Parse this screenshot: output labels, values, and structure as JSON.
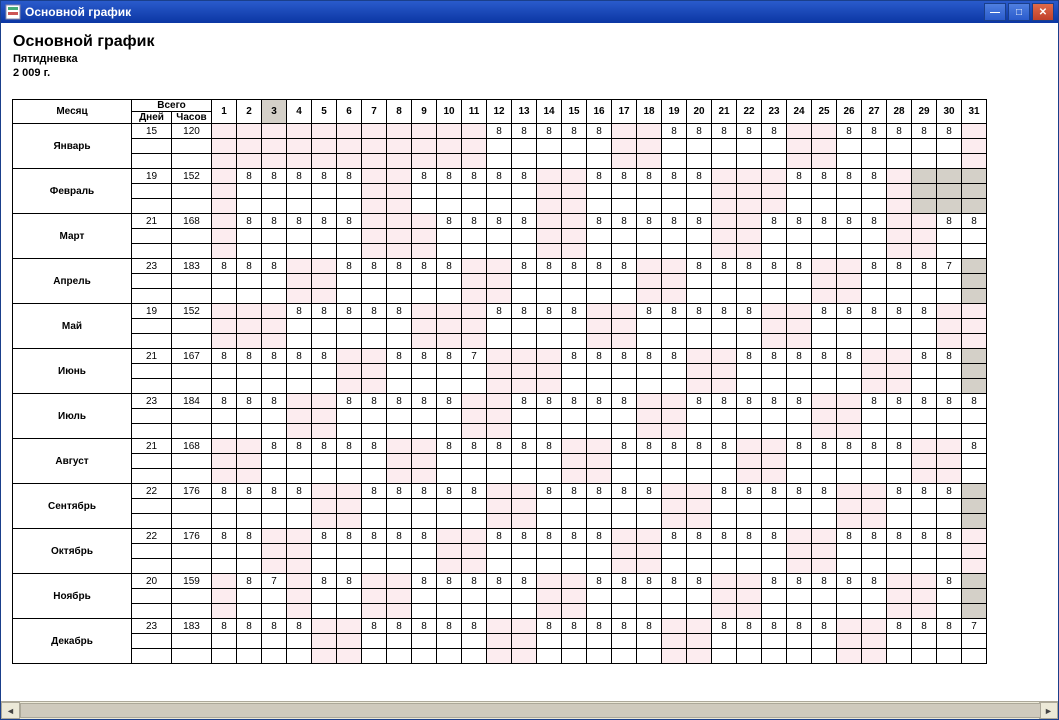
{
  "window": {
    "title": "Основной график"
  },
  "header": {
    "title": "Основной график",
    "subtitle1": "Пятидневка",
    "subtitle2": "2 009 г."
  },
  "cols": {
    "month": "Месяц",
    "total": "Всего",
    "days": "Дней",
    "hours": "Часов",
    "nums": [
      "1",
      "2",
      "3",
      "4",
      "5",
      "6",
      "7",
      "8",
      "9",
      "10",
      "11",
      "12",
      "13",
      "14",
      "15",
      "16",
      "17",
      "18",
      "19",
      "20",
      "21",
      "22",
      "23",
      "24",
      "25",
      "26",
      "27",
      "28",
      "29",
      "30",
      "31"
    ]
  },
  "selectedDay": 3,
  "months": [
    {
      "name": "Январь",
      "days": "15",
      "hours": "120",
      "len": 31,
      "wk": [
        1,
        2,
        3,
        4,
        5,
        6,
        7,
        8,
        9,
        10,
        11,
        17,
        18,
        24,
        25,
        31
      ],
      "cells": {
        "12": "8",
        "13": "8",
        "14": "8",
        "15": "8",
        "16": "8",
        "19": "8",
        "20": "8",
        "21": "8",
        "22": "8",
        "23": "8",
        "26": "8",
        "27": "8",
        "28": "8",
        "29": "8",
        "30": "8"
      }
    },
    {
      "name": "Февраль",
      "days": "19",
      "hours": "152",
      "len": 28,
      "wk": [
        1,
        7,
        8,
        14,
        15,
        21,
        22,
        23,
        28
      ],
      "cells": {
        "2": "8",
        "3": "8",
        "4": "8",
        "5": "8",
        "6": "8",
        "9": "8",
        "10": "8",
        "11": "8",
        "12": "8",
        "13": "8",
        "16": "8",
        "17": "8",
        "18": "8",
        "19": "8",
        "20": "8",
        "24": "8",
        "25": "8",
        "26": "8",
        "27": "8"
      }
    },
    {
      "name": "Март",
      "days": "21",
      "hours": "168",
      "len": 31,
      "wk": [
        1,
        7,
        8,
        9,
        14,
        15,
        21,
        22,
        28,
        29
      ],
      "cells": {
        "2": "8",
        "3": "8",
        "4": "8",
        "5": "8",
        "6": "8",
        "10": "8",
        "11": "8",
        "12": "8",
        "13": "8",
        "16": "8",
        "17": "8",
        "18": "8",
        "19": "8",
        "20": "8",
        "23": "8",
        "24": "8",
        "25": "8",
        "26": "8",
        "27": "8",
        "30": "8",
        "31": "8"
      }
    },
    {
      "name": "Апрель",
      "days": "23",
      "hours": "183",
      "len": 30,
      "wk": [
        4,
        5,
        11,
        12,
        18,
        19,
        25,
        26
      ],
      "cells": {
        "1": "8",
        "2": "8",
        "3": "8",
        "6": "8",
        "7": "8",
        "8": "8",
        "9": "8",
        "10": "8",
        "13": "8",
        "14": "8",
        "15": "8",
        "16": "8",
        "17": "8",
        "20": "8",
        "21": "8",
        "22": "8",
        "23": "8",
        "24": "8",
        "27": "8",
        "28": "8",
        "29": "8",
        "30": "7"
      }
    },
    {
      "name": "Май",
      "days": "19",
      "hours": "152",
      "len": 31,
      "wk": [
        1,
        2,
        3,
        9,
        10,
        11,
        16,
        17,
        23,
        24,
        30,
        31
      ],
      "cells": {
        "4": "8",
        "5": "8",
        "6": "8",
        "7": "8",
        "8": "8",
        "12": "8",
        "13": "8",
        "14": "8",
        "15": "8",
        "18": "8",
        "19": "8",
        "20": "8",
        "21": "8",
        "22": "8",
        "25": "8",
        "26": "8",
        "27": "8",
        "28": "8",
        "29": "8"
      }
    },
    {
      "name": "Июнь",
      "days": "21",
      "hours": "167",
      "len": 30,
      "wk": [
        6,
        7,
        12,
        13,
        14,
        20,
        21,
        27,
        28
      ],
      "cells": {
        "1": "8",
        "2": "8",
        "3": "8",
        "4": "8",
        "5": "8",
        "8": "8",
        "9": "8",
        "10": "8",
        "11": "7",
        "15": "8",
        "16": "8",
        "17": "8",
        "18": "8",
        "19": "8",
        "22": "8",
        "23": "8",
        "24": "8",
        "25": "8",
        "26": "8",
        "29": "8",
        "30": "8"
      }
    },
    {
      "name": "Июль",
      "days": "23",
      "hours": "184",
      "len": 31,
      "wk": [
        4,
        5,
        11,
        12,
        18,
        19,
        25,
        26
      ],
      "cells": {
        "1": "8",
        "2": "8",
        "3": "8",
        "6": "8",
        "7": "8",
        "8": "8",
        "9": "8",
        "10": "8",
        "13": "8",
        "14": "8",
        "15": "8",
        "16": "8",
        "17": "8",
        "20": "8",
        "21": "8",
        "22": "8",
        "23": "8",
        "24": "8",
        "27": "8",
        "28": "8",
        "29": "8",
        "30": "8",
        "31": "8"
      }
    },
    {
      "name": "Август",
      "days": "21",
      "hours": "168",
      "len": 31,
      "wk": [
        1,
        2,
        8,
        9,
        15,
        16,
        22,
        23,
        29,
        30
      ],
      "cells": {
        "3": "8",
        "4": "8",
        "5": "8",
        "6": "8",
        "7": "8",
        "10": "8",
        "11": "8",
        "12": "8",
        "13": "8",
        "14": "8",
        "17": "8",
        "18": "8",
        "19": "8",
        "20": "8",
        "21": "8",
        "24": "8",
        "25": "8",
        "26": "8",
        "27": "8",
        "28": "8",
        "31": "8"
      }
    },
    {
      "name": "Сентябрь",
      "days": "22",
      "hours": "176",
      "len": 30,
      "wk": [
        5,
        6,
        12,
        13,
        19,
        20,
        26,
        27
      ],
      "cells": {
        "1": "8",
        "2": "8",
        "3": "8",
        "4": "8",
        "7": "8",
        "8": "8",
        "9": "8",
        "10": "8",
        "11": "8",
        "14": "8",
        "15": "8",
        "16": "8",
        "17": "8",
        "18": "8",
        "21": "8",
        "22": "8",
        "23": "8",
        "24": "8",
        "25": "8",
        "28": "8",
        "29": "8",
        "30": "8"
      }
    },
    {
      "name": "Октябрь",
      "days": "22",
      "hours": "176",
      "len": 31,
      "wk": [
        3,
        4,
        10,
        11,
        17,
        18,
        24,
        25,
        31
      ],
      "cells": {
        "1": "8",
        "2": "8",
        "5": "8",
        "6": "8",
        "7": "8",
        "8": "8",
        "9": "8",
        "12": "8",
        "13": "8",
        "14": "8",
        "15": "8",
        "16": "8",
        "19": "8",
        "20": "8",
        "21": "8",
        "22": "8",
        "23": "8",
        "26": "8",
        "27": "8",
        "28": "8",
        "29": "8",
        "30": "8"
      }
    },
    {
      "name": "Ноябрь",
      "days": "20",
      "hours": "159",
      "len": 30,
      "wk": [
        1,
        4,
        7,
        8,
        14,
        15,
        21,
        22,
        28,
        29
      ],
      "cells": {
        "2": "8",
        "3": "7",
        "5": "8",
        "6": "8",
        "9": "8",
        "10": "8",
        "11": "8",
        "12": "8",
        "13": "8",
        "16": "8",
        "17": "8",
        "18": "8",
        "19": "8",
        "20": "8",
        "23": "8",
        "24": "8",
        "25": "8",
        "26": "8",
        "27": "8",
        "30": "8"
      }
    },
    {
      "name": "Декабрь",
      "days": "23",
      "hours": "183",
      "len": 31,
      "wk": [
        5,
        6,
        12,
        13,
        19,
        20,
        26,
        27
      ],
      "cells": {
        "1": "8",
        "2": "8",
        "3": "8",
        "4": "8",
        "7": "8",
        "8": "8",
        "9": "8",
        "10": "8",
        "11": "8",
        "14": "8",
        "15": "8",
        "16": "8",
        "17": "8",
        "18": "8",
        "21": "8",
        "22": "8",
        "23": "8",
        "24": "8",
        "25": "8",
        "28": "8",
        "29": "8",
        "30": "8",
        "31": "7"
      }
    }
  ]
}
